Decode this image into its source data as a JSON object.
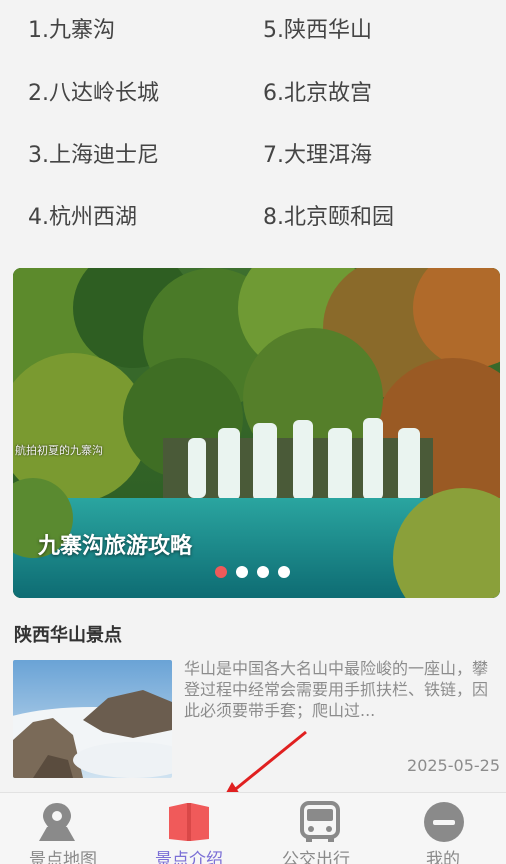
{
  "spots": [
    "1.九寨沟",
    "2.八达岭长城",
    "3.上海迪士尼",
    "4.杭州西湖",
    "5.陕西华山",
    "6.北京故宫",
    "7.大理洱海",
    "8.北京颐和园"
  ],
  "banner": {
    "small_caption": "航拍初夏的九寨沟",
    "title": "九寨沟旅游攻略",
    "slides": 4,
    "active_slide": 1
  },
  "section": {
    "title": "陕西华山景点"
  },
  "article": {
    "text": "华山是中国各大名山中最险峻的一座山，攀登过程中经常会需要用手抓扶栏、铁链，因此必须要带手套；爬山过...",
    "date": "2025-05-25"
  },
  "nav": {
    "items": [
      {
        "label": "景点地图",
        "icon": "map-pin-icon"
      },
      {
        "label": "景点介绍",
        "icon": "book-icon"
      },
      {
        "label": "公交出行",
        "icon": "bus-icon"
      },
      {
        "label": "我的",
        "icon": "user-icon"
      }
    ],
    "active": 1
  },
  "colors": {
    "active_nav_icon": "#f05a5a",
    "active_nav_label": "#7b6fd6",
    "inactive_nav": "#8a8a8a",
    "active_dot": "#ef5a5a",
    "arrow": "#e02020"
  }
}
